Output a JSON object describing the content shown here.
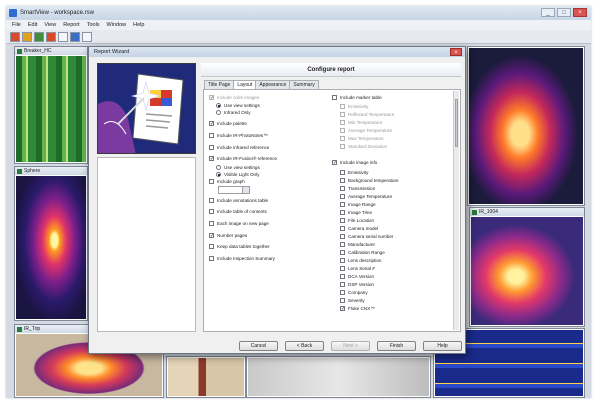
{
  "app": {
    "title": "SmartView - workspace.rsw",
    "menu": [
      "File",
      "Edit",
      "View",
      "Report",
      "Tools",
      "Window",
      "Help"
    ]
  },
  "panels": [
    {
      "title": "Breaker_HC"
    },
    {
      "title": "Sphere"
    },
    {
      "title": "IR_Trip"
    },
    {
      "title": "IR_1004"
    }
  ],
  "dialog": {
    "title": "Report Wizard",
    "header": "Configure report",
    "tabs": [
      "Title Page",
      "Layout",
      "Appearance",
      "Summary"
    ],
    "left_options": [
      {
        "label": "Include color images",
        "checked": true,
        "dim": true,
        "kind": "cb"
      },
      {
        "label": "Use view settings",
        "checked": true,
        "kind": "rb"
      },
      {
        "label": "Infrared Only",
        "checked": false,
        "kind": "rb"
      },
      {
        "label": "Include palette",
        "checked": true,
        "kind": "cb"
      },
      {
        "label": "Include IR-PhotoNotes™",
        "checked": false,
        "kind": "cb"
      },
      {
        "label": "Include infrared reference",
        "checked": false,
        "kind": "cb"
      },
      {
        "label": "Include IR-Fusion® reference",
        "checked": true,
        "kind": "cb"
      },
      {
        "label": "Use view settings",
        "checked": false,
        "kind": "rb"
      },
      {
        "label": "Visible Light Only",
        "checked": true,
        "kind": "rb"
      },
      {
        "label": "Include graph",
        "checked": false,
        "kind": "cb"
      },
      {
        "label": "Include annotations table",
        "checked": false,
        "kind": "cb"
      },
      {
        "label": "Include table of contents",
        "checked": false,
        "kind": "cb"
      },
      {
        "label": "Each image on new page",
        "checked": false,
        "kind": "cb"
      },
      {
        "label": "Number pages",
        "checked": true,
        "kind": "cb"
      },
      {
        "label": "Keep data tables together",
        "checked": false,
        "kind": "cb"
      },
      {
        "label": "Include Inspection Summary",
        "checked": false,
        "kind": "cb"
      }
    ],
    "marker_table": {
      "label": "Include marker table",
      "checked": false
    },
    "marker_options": [
      "Emissivity",
      "Reflected Temperature",
      "Min Temperature",
      "Average Temperature",
      "Max Temperature",
      "Standard Deviation"
    ],
    "image_info": {
      "label": "Include image info",
      "checked": true
    },
    "image_info_options": [
      {
        "label": "Emissivity",
        "checked": false
      },
      {
        "label": "Background temperature",
        "checked": false
      },
      {
        "label": "Transmission",
        "checked": false
      },
      {
        "label": "Average Temperature",
        "checked": false
      },
      {
        "label": "Image Range",
        "checked": false
      },
      {
        "label": "Image Time",
        "checked": false
      },
      {
        "label": "File Location",
        "checked": false
      },
      {
        "label": "Camera model",
        "checked": false
      },
      {
        "label": "Camera serial number",
        "checked": false
      },
      {
        "label": "Manufacturer",
        "checked": false
      },
      {
        "label": "Calibration Range",
        "checked": false
      },
      {
        "label": "Lens description",
        "checked": false
      },
      {
        "label": "Lens Serial #",
        "checked": false
      },
      {
        "label": "DCA Version",
        "checked": false
      },
      {
        "label": "DSP Version",
        "checked": false
      },
      {
        "label": "Company",
        "checked": false
      },
      {
        "label": "Severity",
        "checked": false
      },
      {
        "label": "Fluke CNX™",
        "checked": true
      }
    ],
    "buttons": {
      "cancel": "Cancel",
      "back": "< Back",
      "next": "Next >",
      "finish": "Finish",
      "help": "Help"
    }
  },
  "colors": {
    "dialog_bg": "#f0f0f0",
    "title_bar": "#c3d2e5",
    "close_red": "#d9534f"
  }
}
